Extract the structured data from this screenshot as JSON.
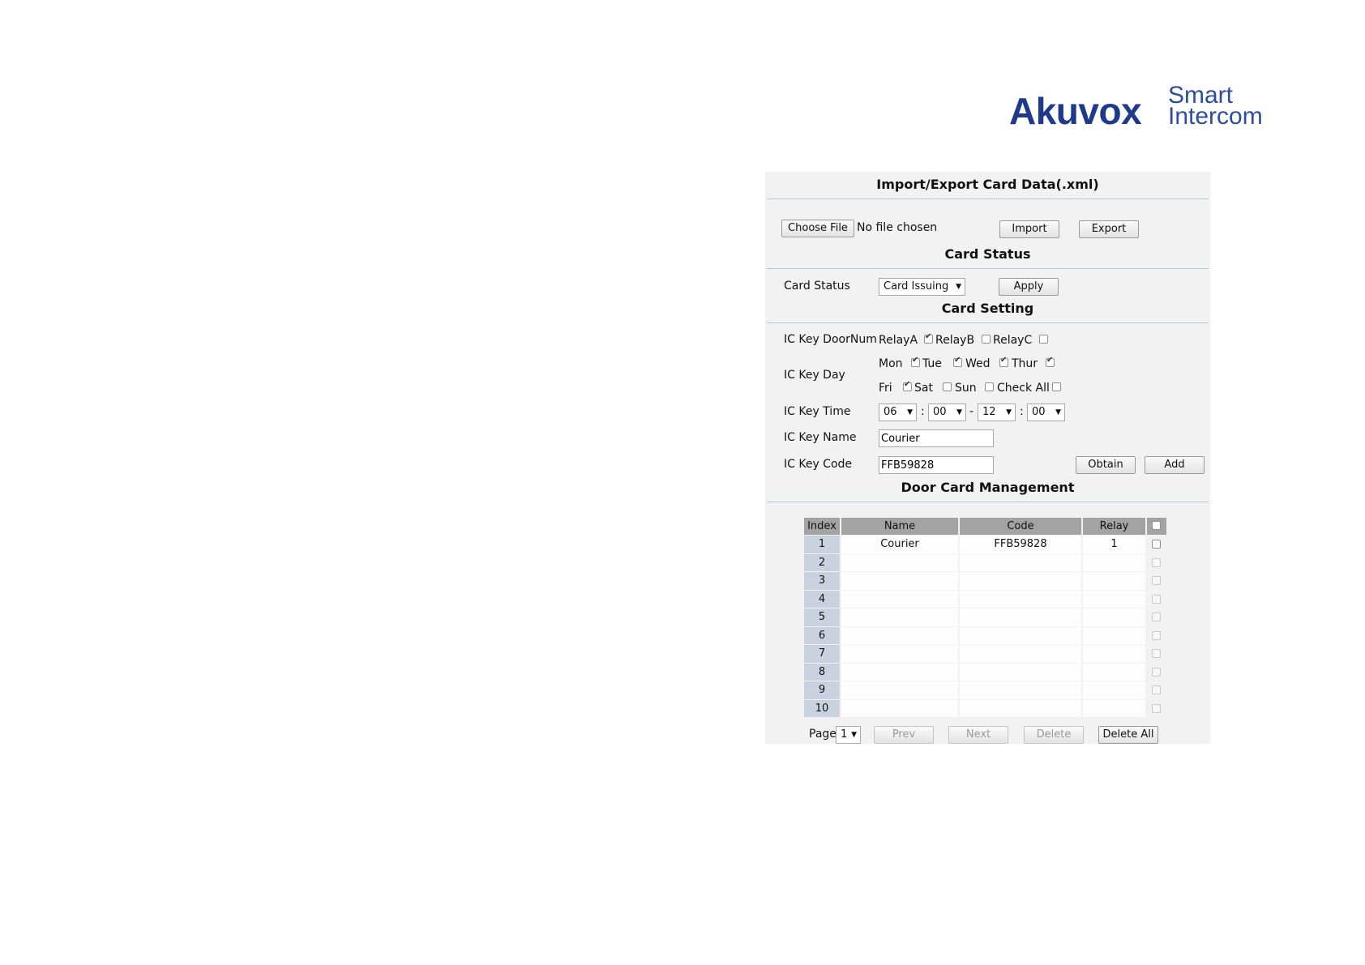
{
  "brand": {
    "name": "Akuvox",
    "tagline_top": "Smart",
    "tagline_bottom": "Intercom"
  },
  "import_export": {
    "title": "Import/Export Card Data(.xml)",
    "choose_file_label": "Choose File",
    "no_file_text": "No file chosen",
    "import_label": "Import",
    "export_label": "Export"
  },
  "card_status": {
    "title": "Card Status",
    "label": "Card Status",
    "selected": "Card Issuing",
    "apply_label": "Apply"
  },
  "card_setting": {
    "title": "Card Setting",
    "door_num_label": "IC Key DoorNum",
    "relays": [
      {
        "label": "RelayA",
        "checked": true
      },
      {
        "label": "RelayB",
        "checked": false
      },
      {
        "label": "RelayC",
        "checked": false
      }
    ],
    "day_label": "IC Key Day",
    "days_row1": [
      {
        "label": "Mon",
        "checked": true
      },
      {
        "label": "Tue",
        "checked": true
      },
      {
        "label": "Wed",
        "checked": true
      },
      {
        "label": "Thur",
        "checked": true
      }
    ],
    "days_row2": [
      {
        "label": "Fri",
        "checked": true
      },
      {
        "label": "Sat",
        "checked": false
      },
      {
        "label": "Sun",
        "checked": false
      },
      {
        "label": "Check All",
        "checked": false
      }
    ],
    "time_label": "IC Key Time",
    "time": {
      "start_hour": "06",
      "start_min": "00",
      "end_hour": "12",
      "end_min": "00",
      "colon": ":",
      "dash": "-"
    },
    "name_label": "IC Key Name",
    "name_value": "Courier",
    "code_label": "IC Key Code",
    "code_value": "FFB59828",
    "obtain_label": "Obtain",
    "add_label": "Add"
  },
  "door_card_management": {
    "title": "Door Card Management",
    "columns": [
      "Index",
      "Name",
      "Code",
      "Relay"
    ],
    "rows": [
      {
        "index": "1",
        "name": "Courier",
        "code": "FFB59828",
        "relay": "1"
      },
      {
        "index": "2",
        "name": "",
        "code": "",
        "relay": ""
      },
      {
        "index": "3",
        "name": "",
        "code": "",
        "relay": ""
      },
      {
        "index": "4",
        "name": "",
        "code": "",
        "relay": ""
      },
      {
        "index": "5",
        "name": "",
        "code": "",
        "relay": ""
      },
      {
        "index": "6",
        "name": "",
        "code": "",
        "relay": ""
      },
      {
        "index": "7",
        "name": "",
        "code": "",
        "relay": ""
      },
      {
        "index": "8",
        "name": "",
        "code": "",
        "relay": ""
      },
      {
        "index": "9",
        "name": "",
        "code": "",
        "relay": ""
      },
      {
        "index": "10",
        "name": "",
        "code": "",
        "relay": ""
      }
    ],
    "page_label": "Page",
    "page_value": "1",
    "prev_label": "Prev",
    "next_label": "Next",
    "delete_label": "Delete",
    "delete_all_label": "Delete All"
  }
}
